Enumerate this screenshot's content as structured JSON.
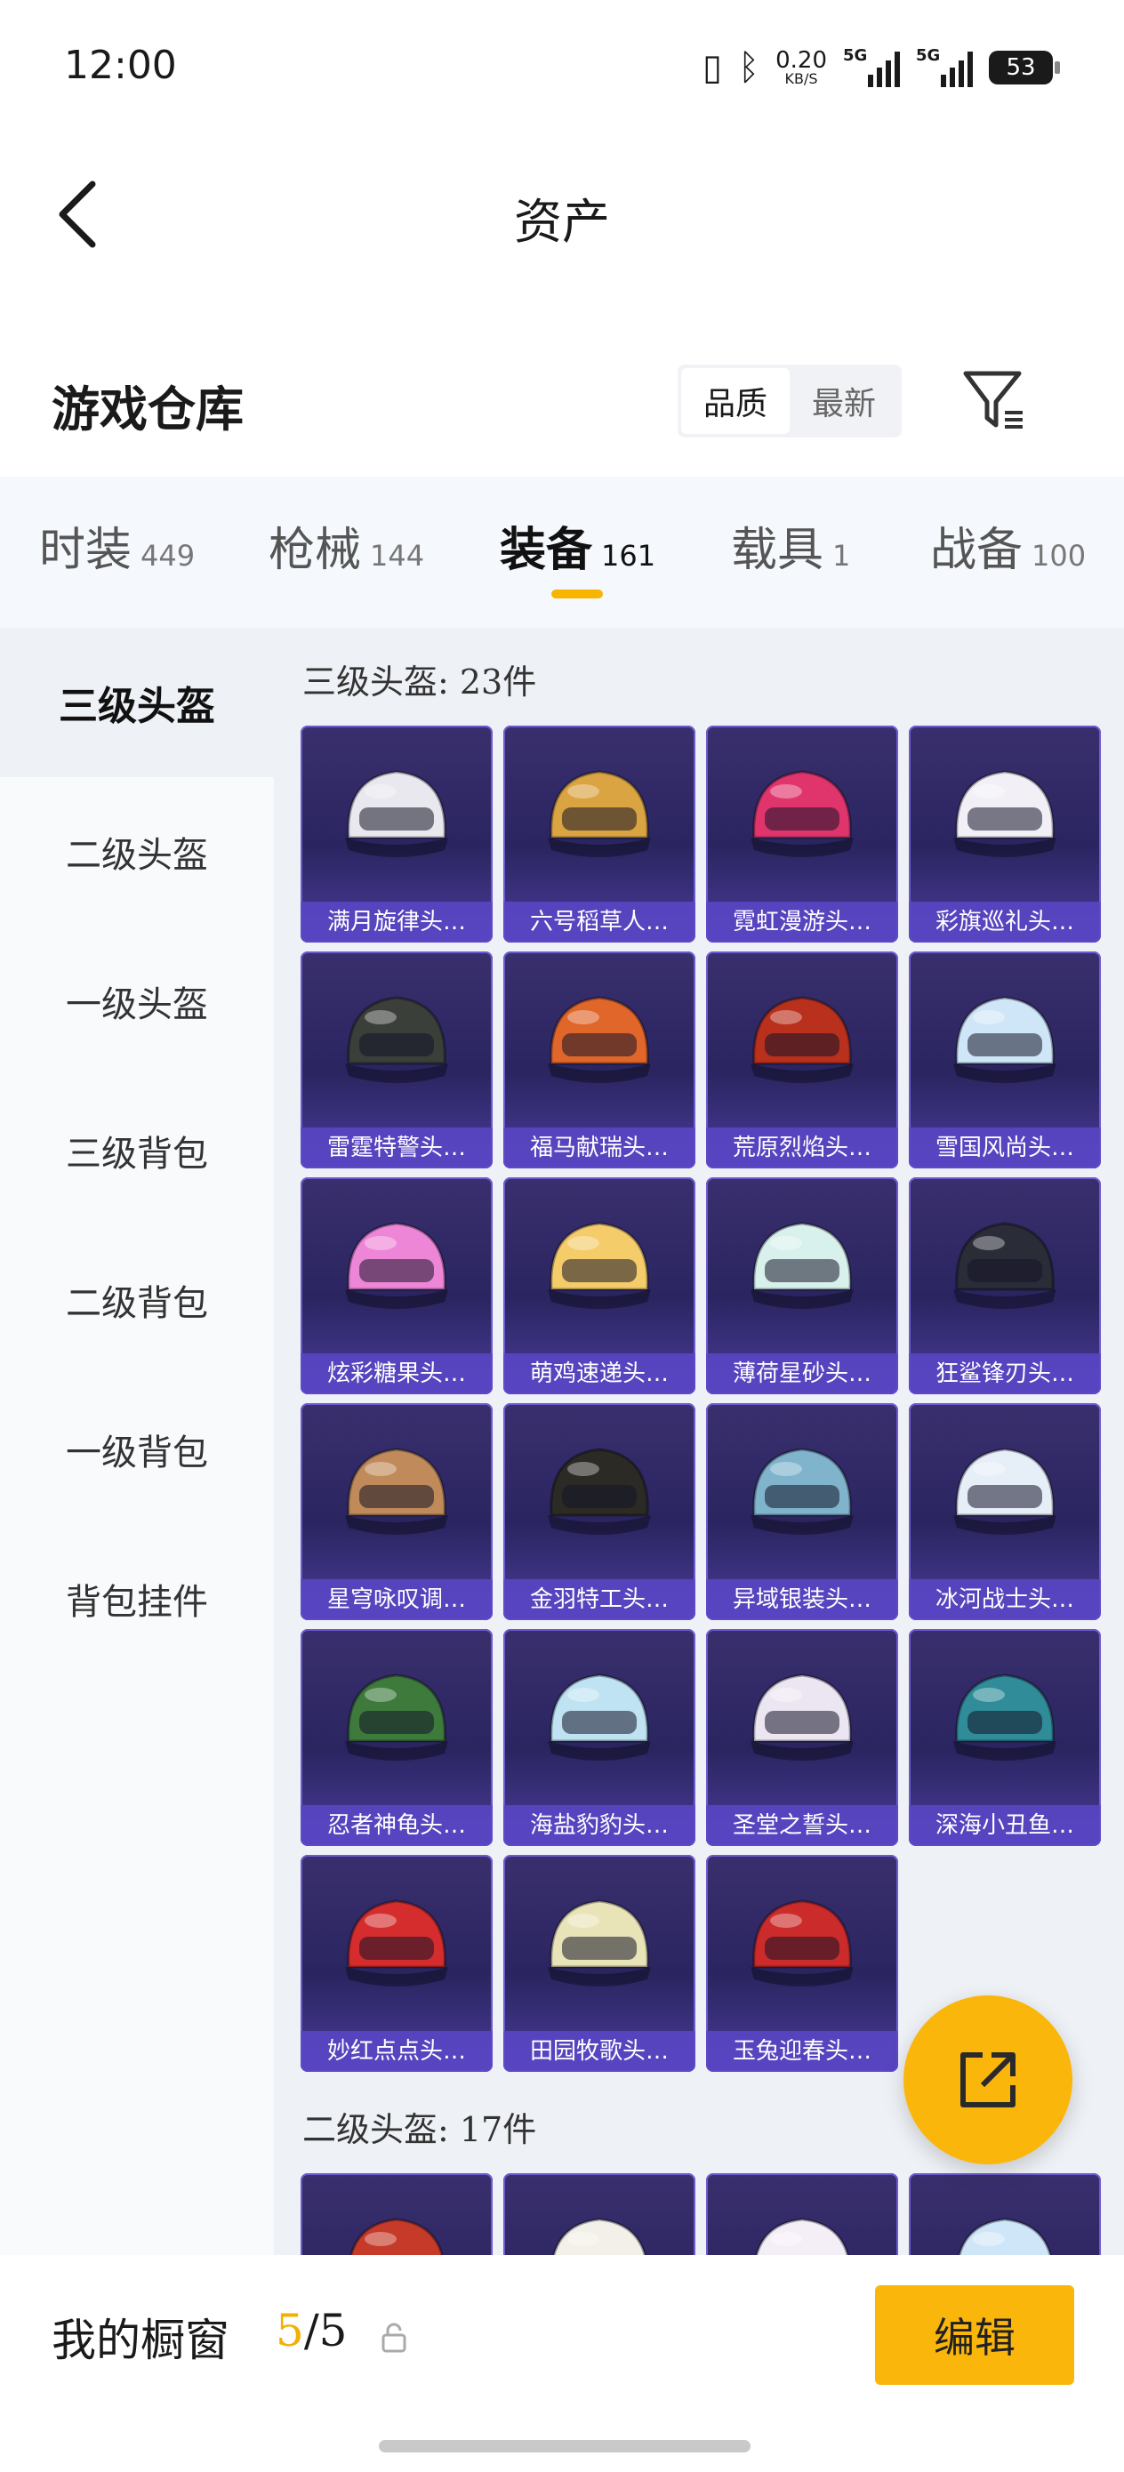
{
  "status": {
    "time": "12:00",
    "net_speed": "0.20",
    "net_unit": "KB/S",
    "signal1": "5G",
    "signal2": "5G",
    "battery": "53"
  },
  "header": {
    "title": "资产"
  },
  "warehouse": {
    "title": "游戏仓库",
    "sort_options": [
      "品质",
      "最新"
    ],
    "active_sort": "品质"
  },
  "tabs": [
    {
      "label": "时装",
      "count": "449"
    },
    {
      "label": "枪械",
      "count": "144"
    },
    {
      "label": "装备",
      "count": "161"
    },
    {
      "label": "载具",
      "count": "1"
    },
    {
      "label": "战备",
      "count": "100"
    }
  ],
  "active_tab": "装备",
  "sidebar": [
    {
      "label": "三级头盔"
    },
    {
      "label": "二级头盔"
    },
    {
      "label": "一级头盔"
    },
    {
      "label": "三级背包"
    },
    {
      "label": "二级背包"
    },
    {
      "label": "一级背包"
    },
    {
      "label": "背包挂件"
    }
  ],
  "groups": [
    {
      "title": "三级头盔: 23件",
      "items": [
        {
          "name": "满月旋律头…",
          "color": "#e8e8ee"
        },
        {
          "name": "六号稻草人…",
          "color": "#d9a441"
        },
        {
          "name": "霓虹漫游头…",
          "color": "#e0356c"
        },
        {
          "name": "彩旗巡礼头…",
          "color": "#f2f0f6"
        },
        {
          "name": "雷霆特警头…",
          "color": "#3b3f3a"
        },
        {
          "name": "福马献瑞头…",
          "color": "#e0662a"
        },
        {
          "name": "荒原烈焰头…",
          "color": "#b9301d"
        },
        {
          "name": "雪国风尚头…",
          "color": "#cfe6f8"
        },
        {
          "name": "炫彩糖果头…",
          "color": "#ee86d8"
        },
        {
          "name": "萌鸡速递头…",
          "color": "#f4cc6a"
        },
        {
          "name": "薄荷星砂头…",
          "color": "#d9f1ec"
        },
        {
          "name": "狂鲨锋刃头…",
          "color": "#2a2c38"
        },
        {
          "name": "星穹咏叹调…",
          "color": "#c08a5a"
        },
        {
          "name": "金羽特工头…",
          "color": "#2c2a24"
        },
        {
          "name": "异域银装头…",
          "color": "#7fb4cc"
        },
        {
          "name": "冰河战士头…",
          "color": "#e6eef8"
        },
        {
          "name": "忍者神龟头…",
          "color": "#3d7a3c"
        },
        {
          "name": "海盐豹豹头…",
          "color": "#bfe3f2"
        },
        {
          "name": "圣堂之誓头…",
          "color": "#ece6f2"
        },
        {
          "name": "深海小丑鱼…",
          "color": "#2f8c98"
        },
        {
          "name": "妙红点点头…",
          "color": "#d52d2d"
        },
        {
          "name": "田园牧歌头…",
          "color": "#e9e3b8"
        },
        {
          "name": "玉兔迎春头…",
          "color": "#cc2b2b"
        }
      ]
    },
    {
      "title": "二级头盔: 17件",
      "items": [
        {
          "name": "",
          "color": "#c63a2a"
        },
        {
          "name": "",
          "color": "#f2f0e8"
        },
        {
          "name": "",
          "color": "#f4eef6"
        },
        {
          "name": "",
          "color": "#cfe6f8"
        }
      ]
    }
  ],
  "bottom": {
    "label": "我的橱窗",
    "current": "5",
    "total": "/5",
    "edit": "编辑"
  }
}
